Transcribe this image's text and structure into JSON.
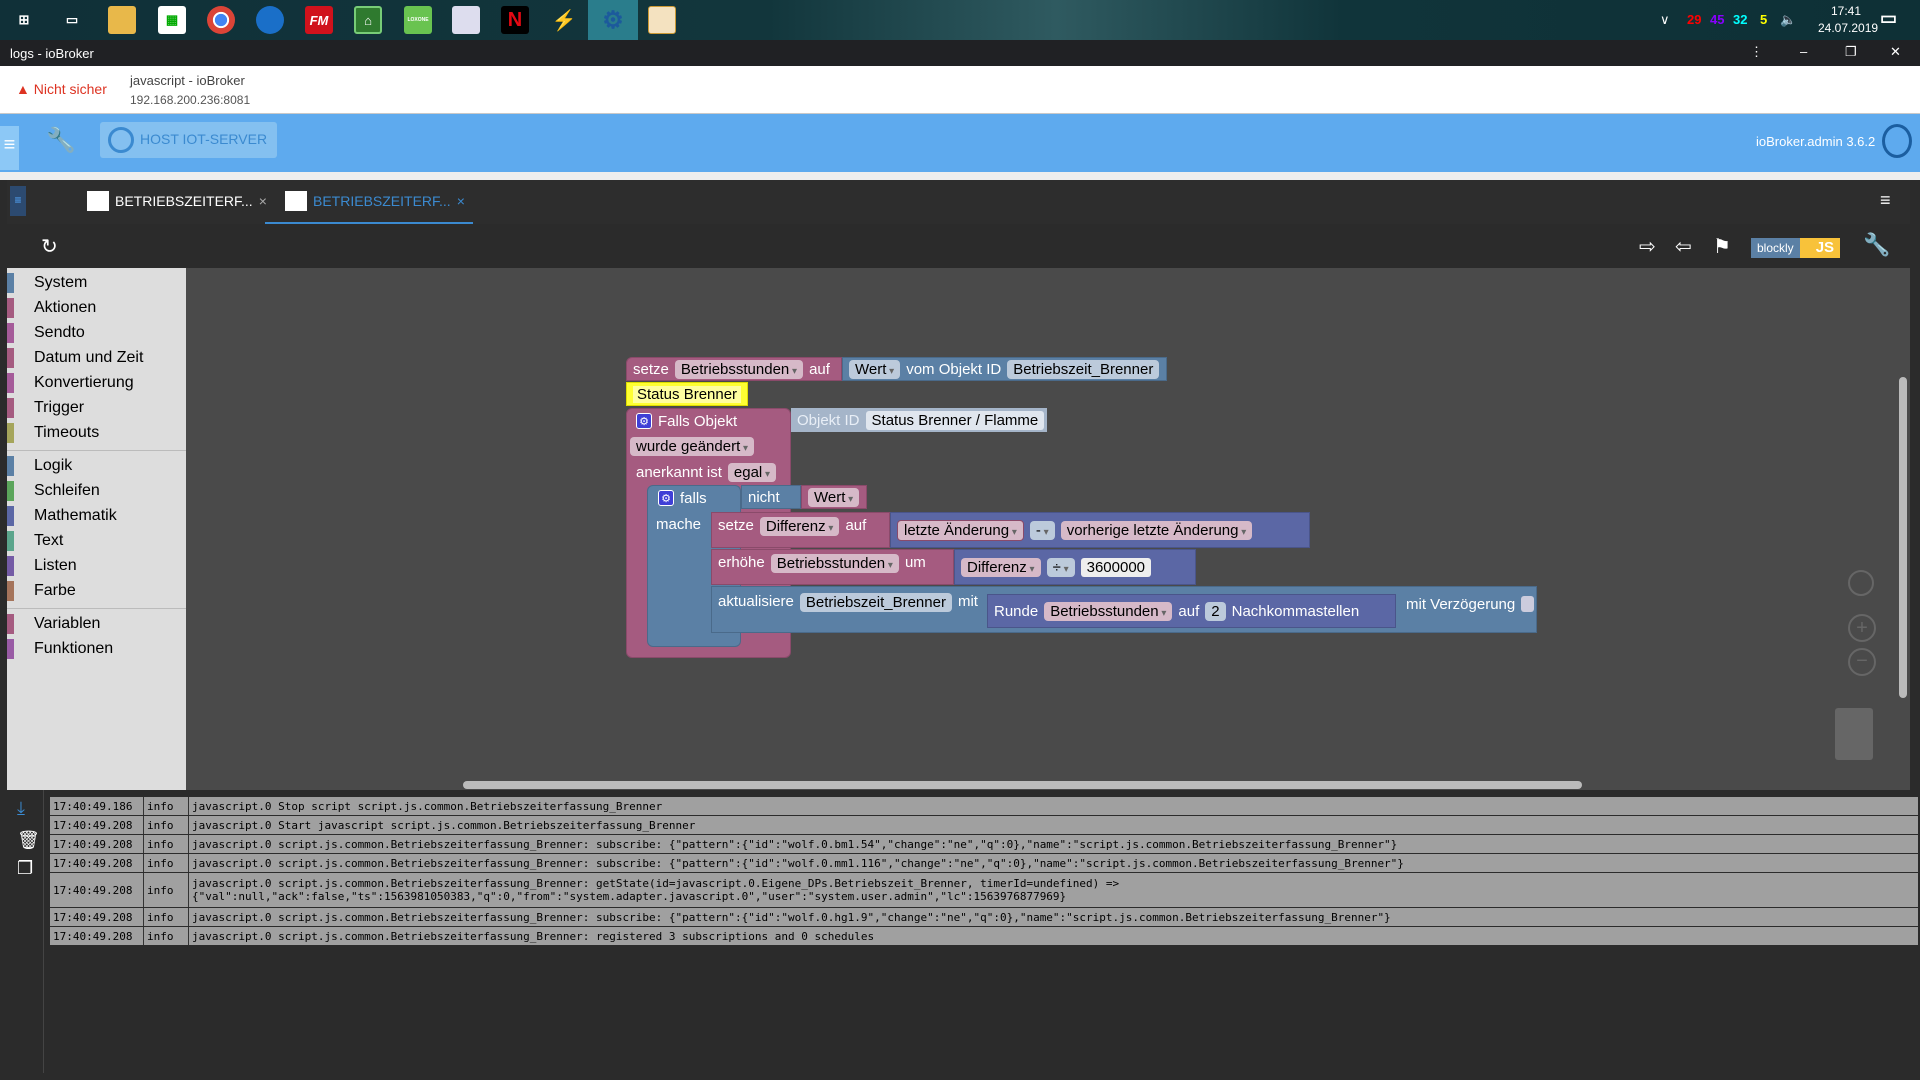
{
  "taskbar": {
    "icons": [
      "windows-start",
      "task-view",
      "file-explorer",
      "ms-store",
      "chrome",
      "thunderbird",
      "fm",
      "app-green-house",
      "loxone",
      "app-document",
      "netflix",
      "winamp",
      "iobroker-gear",
      "libreoffice-draw"
    ],
    "fm_label": "FM",
    "loxone_label": "LOXONE",
    "netflix_label": "N",
    "tray": {
      "n1": "29",
      "n2": "45",
      "n3": "32",
      "n4": "5",
      "time": "17:41",
      "date": "24.07.2019"
    }
  },
  "window": {
    "title": "logs - ioBroker"
  },
  "address": {
    "security": "Nicht sicher",
    "page_title": "javascript - ioBroker",
    "url": "192.168.200.236:8081"
  },
  "header": {
    "host": "HOST IOT-SERVER",
    "version": "ioBroker.admin 3.6.2"
  },
  "tabs": [
    {
      "label": "BETRIEBSZEITERF...",
      "active": false
    },
    {
      "label": "BETRIEBSZEITERF...",
      "active": true
    }
  ],
  "toolbar": {
    "blockly": "blockly",
    "js": "JS"
  },
  "sidebar": {
    "groups": [
      [
        {
          "label": "System",
          "color": "#5b80a5"
        },
        {
          "label": "Aktionen",
          "color": "#a55b80"
        },
        {
          "label": "Sendto",
          "color": "#a55b99"
        },
        {
          "label": "Datum und Zeit",
          "color": "#a55b80"
        },
        {
          "label": "Konvertierung",
          "color": "#a55b99"
        },
        {
          "label": "Trigger",
          "color": "#a55b80"
        },
        {
          "label": "Timeouts",
          "color": "#a5a55b"
        }
      ],
      [
        {
          "label": "Logik",
          "color": "#5b80a5"
        },
        {
          "label": "Schleifen",
          "color": "#5ba55b"
        },
        {
          "label": "Mathematik",
          "color": "#5b67a5"
        },
        {
          "label": "Text",
          "color": "#5ba58c"
        },
        {
          "label": "Listen",
          "color": "#745ba5"
        },
        {
          "label": "Farbe",
          "color": "#a5745b"
        }
      ],
      [
        {
          "label": "Variablen",
          "color": "#a55b80"
        },
        {
          "label": "Funktionen",
          "color": "#995ba5"
        }
      ]
    ]
  },
  "blocks": {
    "set1": {
      "setze": "setze",
      "var": "Betriebsstunden",
      "auf": "auf",
      "wert": "Wert",
      "vom": "vom Objekt ID",
      "obj": "Betriebszeit_Brenner"
    },
    "comment": "Status Brenner",
    "trigger": {
      "falls_objekt": "Falls Objekt",
      "objekt_id": "Objekt ID",
      "obj": "Status Brenner / Flamme",
      "changed": "wurde geändert",
      "ack_label": "anerkannt ist",
      "ack": "egal"
    },
    "if": {
      "falls": "falls",
      "mache": "mache",
      "nicht": "nicht",
      "wert": "Wert"
    },
    "set2": {
      "setze": "setze",
      "var": "Differenz",
      "auf": "auf",
      "a": "letzte Änderung",
      "op": "-",
      "b": "vorherige letzte Änderung"
    },
    "inc": {
      "label": "erhöhe",
      "var": "Betriebsstunden",
      "um": "um",
      "a": "Differenz",
      "op": "÷",
      "b": "3600000"
    },
    "update": {
      "label": "aktualisiere",
      "obj": "Betriebszeit_Brenner",
      "mit": "mit",
      "runde": "Runde",
      "var": "Betriebsstunden",
      "auf": "auf",
      "n": "2",
      "nachk": "Nachkommastellen",
      "delay": "mit Verzögerung"
    }
  },
  "log": [
    {
      "time": "17:40:49.186",
      "sev": "info",
      "msg": "javascript.0 Stop script script.js.common.Betriebszeiterfassung_Brenner"
    },
    {
      "time": "17:40:49.208",
      "sev": "info",
      "msg": "javascript.0 Start javascript script.js.common.Betriebszeiterfassung_Brenner"
    },
    {
      "time": "17:40:49.208",
      "sev": "info",
      "msg": "javascript.0 script.js.common.Betriebszeiterfassung_Brenner: subscribe: {\"pattern\":{\"id\":\"wolf.0.bm1.54\",\"change\":\"ne\",\"q\":0},\"name\":\"script.js.common.Betriebszeiterfassung_Brenner\"}"
    },
    {
      "time": "17:40:49.208",
      "sev": "info",
      "msg": "javascript.0 script.js.common.Betriebszeiterfassung_Brenner: subscribe: {\"pattern\":{\"id\":\"wolf.0.mm1.116\",\"change\":\"ne\",\"q\":0},\"name\":\"script.js.common.Betriebszeiterfassung_Brenner\"}"
    },
    {
      "time": "17:40:49.208",
      "sev": "info",
      "msg": "javascript.0 script.js.common.Betriebszeiterfassung_Brenner: getState(id=javascript.0.Eigene_DPs.Betriebszeit_Brenner, timerId=undefined) =>\n{\"val\":null,\"ack\":false,\"ts\":1563981050383,\"q\":0,\"from\":\"system.adapter.javascript.0\",\"user\":\"system.user.admin\",\"lc\":1563976877969}"
    },
    {
      "time": "17:40:49.208",
      "sev": "info",
      "msg": "javascript.0 script.js.common.Betriebszeiterfassung_Brenner: subscribe: {\"pattern\":{\"id\":\"wolf.0.hg1.9\",\"change\":\"ne\",\"q\":0},\"name\":\"script.js.common.Betriebszeiterfassung_Brenner\"}"
    },
    {
      "time": "17:40:49.208",
      "sev": "info",
      "msg": "javascript.0 script.js.common.Betriebszeiterfassung_Brenner: registered 3 subscriptions and 0 schedules"
    }
  ]
}
